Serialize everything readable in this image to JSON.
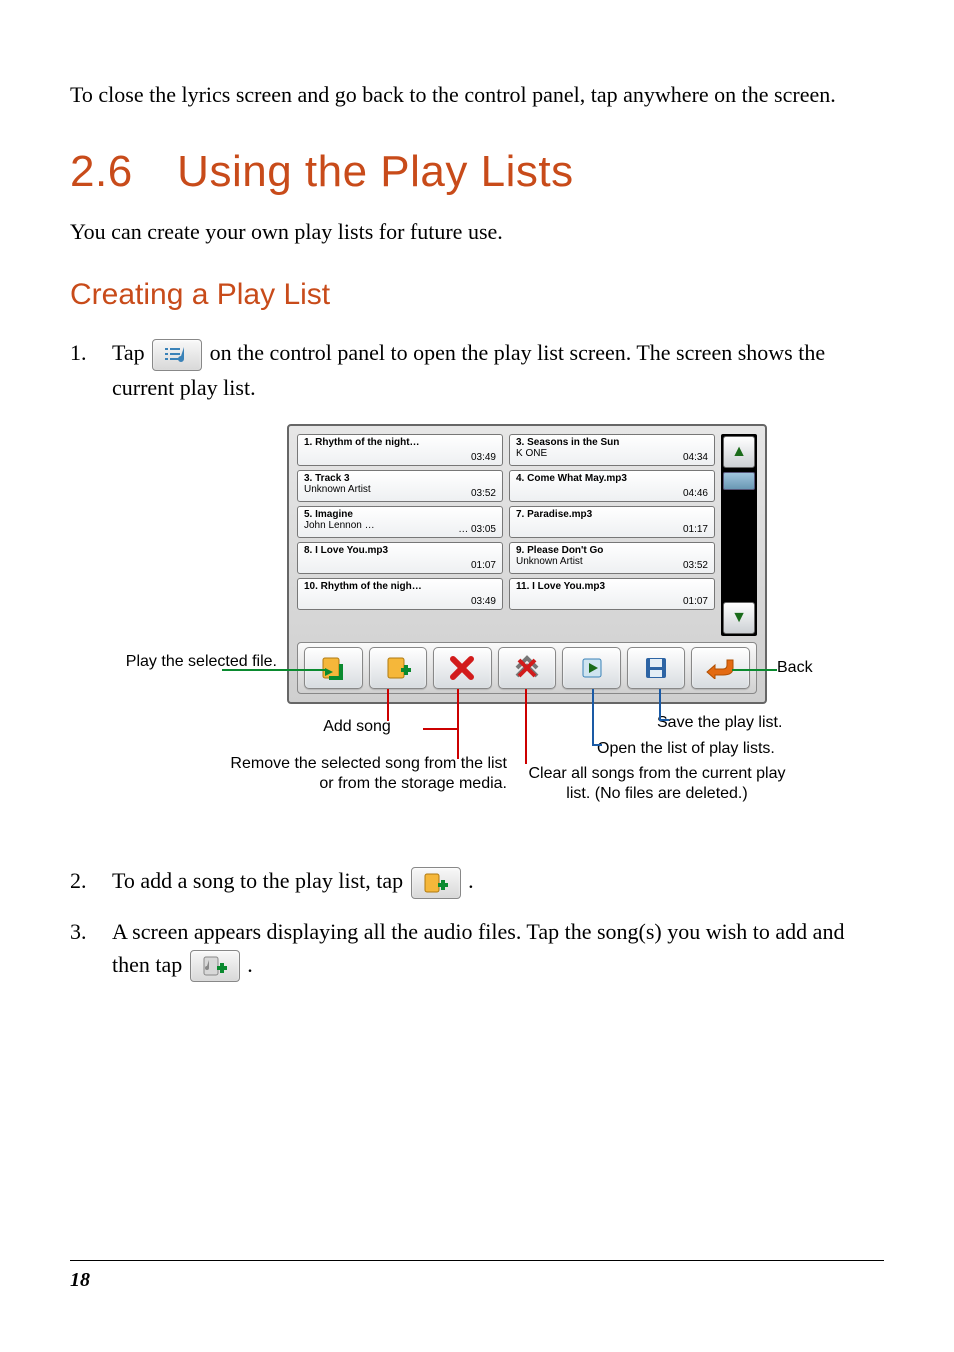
{
  "intro_para": "To close the lyrics screen and go back to the control panel, tap anywhere on the screen.",
  "heading_main": "2.6 Using the Play Lists",
  "para_after_h1": "You can create your own play lists for future use.",
  "heading_sub": "Creating a Play List",
  "steps": {
    "s1_num": "1.",
    "s1_a": "Tap ",
    "s1_b": " on the control panel to open the play list screen. The screen shows the current play list.",
    "s2_num": "2.",
    "s2_a": "To add a song to the play list, tap ",
    "s2_b": ".",
    "s3_num": "3.",
    "s3_a": "A screen appears displaying all the audio files. Tap the song(s) you wish to add and then tap ",
    "s3_b": "."
  },
  "playlist": [
    {
      "title": "1. Rhythm of the night…",
      "sub": "",
      "dur": "03:49"
    },
    {
      "title": "3. Seasons in the Sun",
      "sub": "K ONE",
      "dur": "04:34"
    },
    {
      "title": "3. Track 3",
      "sub": "Unknown Artist",
      "dur": "03:52"
    },
    {
      "title": "4. Come What May.mp3",
      "sub": "",
      "dur": "04:46"
    },
    {
      "title": "5. Imagine",
      "sub": "John Lennon   …",
      "dur": "… 03:05"
    },
    {
      "title": "7. Paradise.mp3",
      "sub": "",
      "dur": "01:17"
    },
    {
      "title": "8. I Love You.mp3",
      "sub": "",
      "dur": "01:07"
    },
    {
      "title": "9. Please Don't Go",
      "sub": "Unknown Artist",
      "dur": "03:52"
    },
    {
      "title": "10. Rhythm of the nigh…",
      "sub": "",
      "dur": "03:49"
    },
    {
      "title": "11. I Love You.mp3",
      "sub": "",
      "dur": "01:07"
    }
  ],
  "callouts": {
    "play": "Play the selected file.",
    "add": "Add song",
    "remove": "Remove the selected song from the list or from the storage media.",
    "clear": "Clear all songs from the current play list. (No files are deleted.)",
    "open": "Open the list of play lists.",
    "save": "Save the play list.",
    "back": "Back"
  },
  "page_number": "18"
}
